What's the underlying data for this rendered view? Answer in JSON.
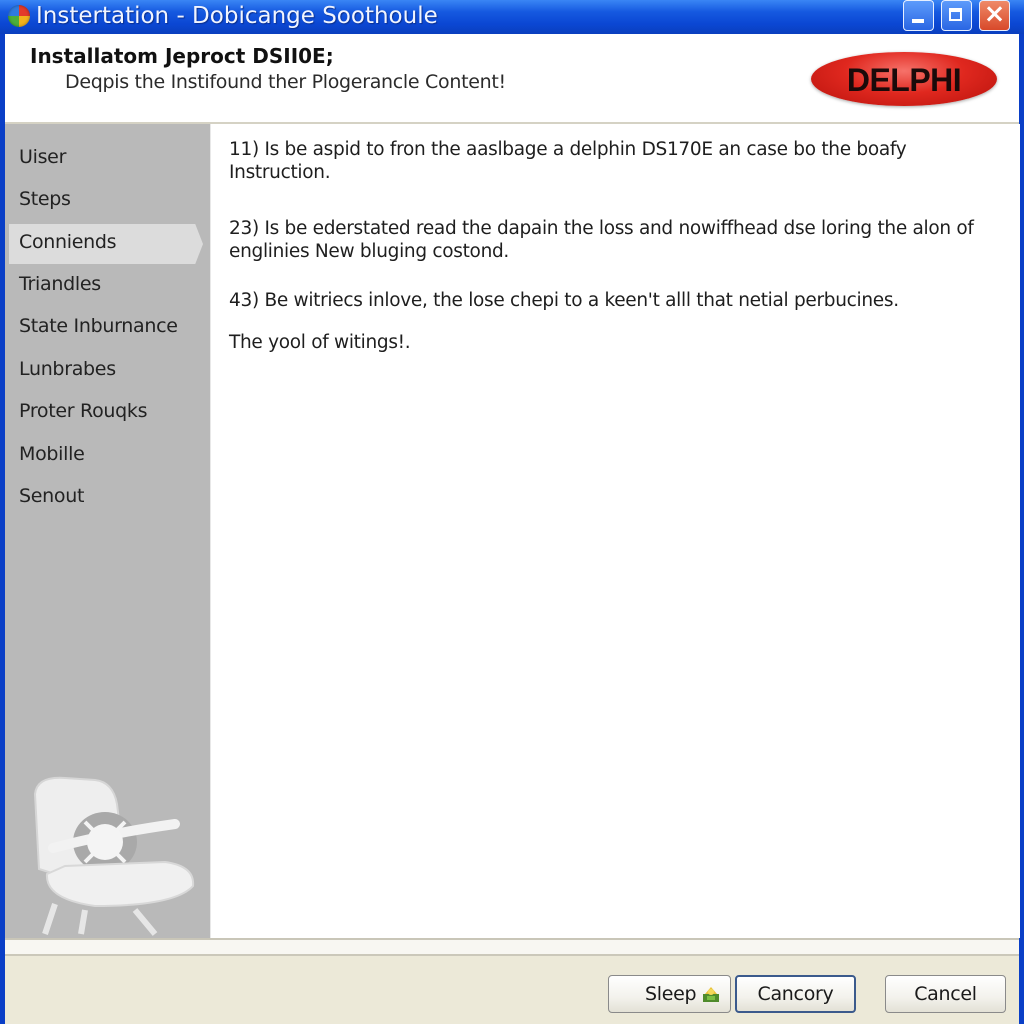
{
  "window": {
    "title": "Instertation - Dobicange Soothoule",
    "app_icon": "multicolor-globe-icon",
    "controls": {
      "minimize": "minimize-icon",
      "maximize": "maximize-icon",
      "close": "×"
    }
  },
  "header": {
    "title": "Installatom Jeproct  DSII0E;",
    "subtitle": "Deqpis the Instifound ther Plogerancle Content!",
    "logo_text": "DELPHI",
    "logo_color": "#e0281f"
  },
  "sidebar": {
    "active_index": 2,
    "items": [
      {
        "label": "Uiser"
      },
      {
        "label": "Steps"
      },
      {
        "label": "Conniends"
      },
      {
        "label": "Triandles"
      },
      {
        "label": "State Inburnance"
      },
      {
        "label": "Lunbrabes"
      },
      {
        "label": "Proter Rouqks"
      },
      {
        "label": "Mobille"
      },
      {
        "label": "Senout"
      }
    ],
    "illustration": "office-chair-icon"
  },
  "content": {
    "paragraphs": [
      "11) Is be aspid to fron the aaslbage a delphin DS170E an case bo the boafy Instruction.",
      "23) Is be ederstated read the dapain the loss and nowiffhead dse loring the alon of englinies New bluging costond.",
      "43) Be witriecs inlove, the lose chepi to a keen't alll that netial perbucines.",
      "The yool of witings!."
    ]
  },
  "footer": {
    "buttons": {
      "sleep": "Sleep",
      "cancory": "Cancory",
      "cancel": "Cancel"
    },
    "sleep_icon": "install-package-icon"
  }
}
